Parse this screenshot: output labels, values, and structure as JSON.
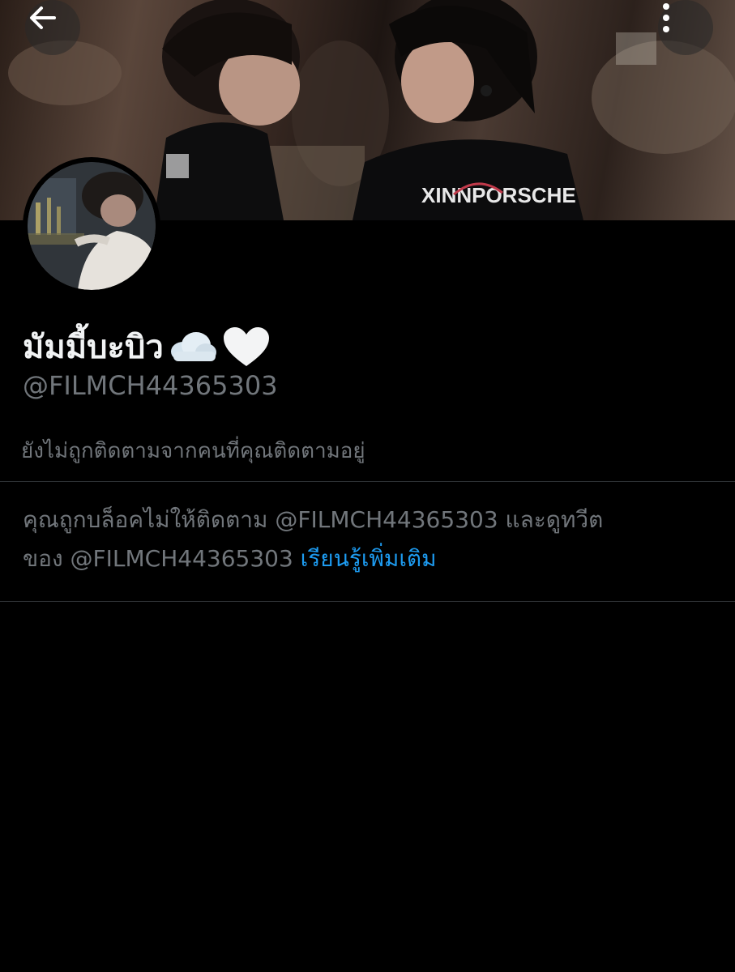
{
  "header": {
    "back_icon": "arrow-left-icon",
    "more_icon": "more-vertical-icon"
  },
  "banner": {
    "shirt_text": "XINNPORSCHE"
  },
  "profile": {
    "display_name": "มัมมี้บะบิว",
    "display_name_emojis": [
      "cloud-icon",
      "white-heart-icon"
    ],
    "handle": "@FILMCH44365303",
    "follow_status": "ยังไม่ถูกติดตามจากคนที่คุณติดตามอยู่"
  },
  "blocked_notice": {
    "line1_prefix": "คุณถูกบล็อคไม่ให้ติดตาม @FILMCH44365303 และดูทวีต",
    "line2_prefix": "ของ @FILMCH44365303 ",
    "learn_more": "เรียนรู้เพิ่มเติม"
  },
  "colors": {
    "background": "#000000",
    "primary_text": "#e7e9ea",
    "secondary_text": "#71767b",
    "link": "#1d9bf0",
    "divider": "#2f3336"
  }
}
